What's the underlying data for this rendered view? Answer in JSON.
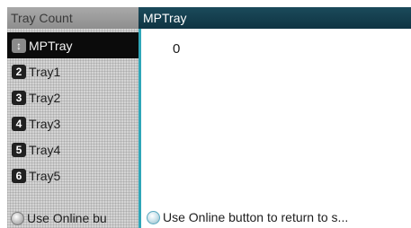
{
  "sidebar": {
    "header": "Tray Count",
    "items": [
      {
        "label": "MPTray",
        "badge": "↕",
        "selected": true
      },
      {
        "label": "Tray1",
        "badge": "2",
        "selected": false
      },
      {
        "label": "Tray2",
        "badge": "3",
        "selected": false
      },
      {
        "label": "Tray3",
        "badge": "4",
        "selected": false
      },
      {
        "label": "Tray4",
        "badge": "5",
        "selected": false
      },
      {
        "label": "Tray5",
        "badge": "6",
        "selected": false
      }
    ],
    "footer": "Use Online bu"
  },
  "panel": {
    "title": "MPTray",
    "count": "0",
    "footer": "Use Online button to return to s..."
  },
  "colors": {
    "header_dark": "#0f3443",
    "accent": "#2fa6b8",
    "selected_bg": "#0b0b0b"
  }
}
